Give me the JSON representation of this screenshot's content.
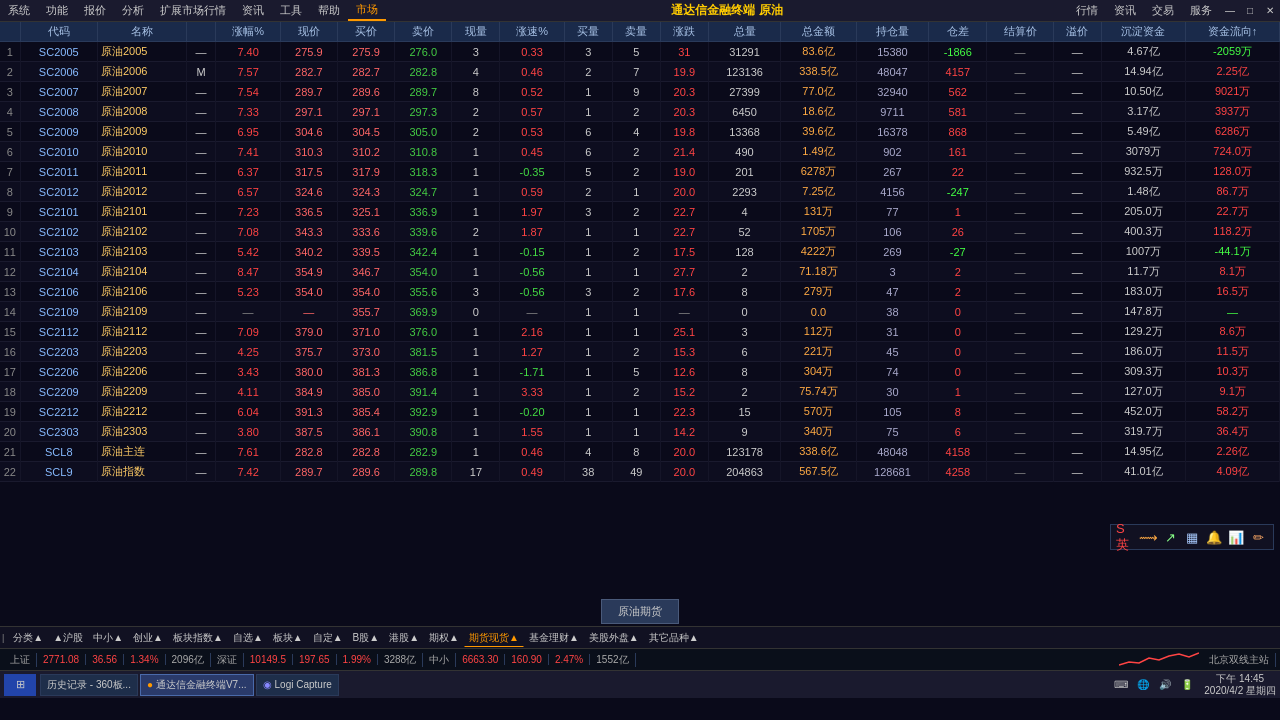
{
  "app": {
    "title": "通达信金融终端 原油",
    "menu": [
      "系统",
      "功能",
      "报价",
      "分析",
      "扩展市场行情",
      "资讯",
      "工具",
      "帮助",
      "市场"
    ],
    "window_controls": [
      "行情",
      "资讯",
      "交易",
      "服务"
    ]
  },
  "table": {
    "headers": [
      "",
      "代码",
      "名称",
      "",
      "涨幅%",
      "现价",
      "买价",
      "卖价",
      "现量",
      "涨速%",
      "买量",
      "卖量",
      "涨跌",
      "总量",
      "总金额",
      "持仓量",
      "仓差",
      "结算价",
      "溢价",
      "沉淀资金",
      "资金流向↑"
    ],
    "rows": [
      {
        "num": "1",
        "code": "SC2005",
        "name": "原油2005",
        "flag": "",
        "pct": "7.40",
        "price": "275.9",
        "buy": "275.9",
        "sell": "276.0",
        "vol": "3",
        "spd": "0.33",
        "bvol": "3",
        "svol": "5",
        "change": "31",
        "total": "31291",
        "amount": "83.6亿",
        "hold": "15380",
        "diff": "-1866",
        "settle": "—",
        "limit": "",
        "assets": "4.67亿",
        "flow": "-2059万"
      },
      {
        "num": "2",
        "code": "SC2006",
        "name": "原油2006",
        "flag": "M",
        "pct": "7.57",
        "price": "282.7",
        "buy": "282.7",
        "sell": "282.8",
        "vol": "4",
        "spd": "0.46",
        "bvol": "2",
        "svol": "7",
        "change": "19.9",
        "total": "123136",
        "amount": "338.5亿",
        "hold": "48047",
        "diff": "4157",
        "settle": "—",
        "limit": "",
        "assets": "14.94亿",
        "flow": "2.25亿"
      },
      {
        "num": "3",
        "code": "SC2007",
        "name": "原油2007",
        "flag": "",
        "pct": "7.54",
        "price": "289.7",
        "buy": "289.6",
        "sell": "289.7",
        "vol": "8",
        "spd": "0.52",
        "bvol": "1",
        "svol": "9",
        "change": "20.3",
        "total": "27399",
        "amount": "77.0亿",
        "hold": "32940",
        "diff": "562",
        "settle": "—",
        "limit": "",
        "assets": "10.50亿",
        "flow": "9021万"
      },
      {
        "num": "4",
        "code": "SC2008",
        "name": "原油2008",
        "flag": "",
        "pct": "7.33",
        "price": "297.1",
        "buy": "297.1",
        "sell": "297.3",
        "vol": "2",
        "spd": "0.57",
        "bvol": "1",
        "svol": "2",
        "change": "20.3",
        "total": "6450",
        "amount": "18.6亿",
        "hold": "9711",
        "diff": "581",
        "settle": "—",
        "limit": "",
        "assets": "3.17亿",
        "flow": "3937万"
      },
      {
        "num": "5",
        "code": "SC2009",
        "name": "原油2009",
        "flag": "",
        "pct": "6.95",
        "price": "304.6",
        "buy": "304.5",
        "sell": "305.0",
        "vol": "2",
        "spd": "0.53",
        "bvol": "6",
        "svol": "4",
        "change": "19.8",
        "total": "13368",
        "amount": "39.6亿",
        "hold": "16378",
        "diff": "868",
        "settle": "—",
        "limit": "",
        "assets": "5.49亿",
        "flow": "6286万"
      },
      {
        "num": "6",
        "code": "SC2010",
        "name": "原油2010",
        "flag": "",
        "pct": "7.41",
        "price": "310.3",
        "buy": "310.2",
        "sell": "310.8",
        "vol": "1",
        "spd": "0.45",
        "bvol": "6",
        "svol": "2",
        "change": "21.4",
        "total": "490",
        "amount": "1.49亿",
        "hold": "902",
        "diff": "161",
        "settle": "—",
        "limit": "",
        "assets": "3079万",
        "flow": "724.0万"
      },
      {
        "num": "7",
        "code": "SC2011",
        "name": "原油2011",
        "flag": "",
        "pct": "6.37",
        "price": "317.5",
        "buy": "317.9",
        "sell": "318.3",
        "vol": "1",
        "spd": "-0.35",
        "bvol": "5",
        "svol": "2",
        "change": "19.0",
        "total": "201",
        "amount": "6278万",
        "hold": "267",
        "diff": "22",
        "settle": "—",
        "limit": "",
        "assets": "932.5万",
        "flow": "128.0万"
      },
      {
        "num": "8",
        "code": "SC2012",
        "name": "原油2012",
        "flag": "",
        "pct": "6.57",
        "price": "324.6",
        "buy": "324.3",
        "sell": "324.7",
        "vol": "1",
        "spd": "0.59",
        "bvol": "2",
        "svol": "1",
        "change": "20.0",
        "total": "2293",
        "amount": "7.25亿",
        "hold": "4156",
        "diff": "-247",
        "settle": "—",
        "limit": "",
        "assets": "1.48亿",
        "flow": "86.7万"
      },
      {
        "num": "9",
        "code": "SC2101",
        "name": "原油2101",
        "flag": "",
        "pct": "7.23",
        "price": "336.5",
        "buy": "325.1",
        "sell": "336.9",
        "vol": "1",
        "spd": "1.97",
        "bvol": "3",
        "svol": "2",
        "change": "22.7",
        "total": "4",
        "amount": "131万",
        "hold": "77",
        "diff": "1",
        "settle": "—",
        "limit": "",
        "assets": "205.0万",
        "flow": "22.7万"
      },
      {
        "num": "10",
        "code": "SC2102",
        "name": "原油2102",
        "flag": "",
        "pct": "7.08",
        "price": "343.3",
        "buy": "333.6",
        "sell": "339.6",
        "vol": "2",
        "spd": "1.87",
        "bvol": "1",
        "svol": "1",
        "change": "22.7",
        "total": "52",
        "amount": "1705万",
        "hold": "106",
        "diff": "26",
        "settle": "—",
        "limit": "",
        "assets": "400.3万",
        "flow": "118.2万"
      },
      {
        "num": "11",
        "code": "SC2103",
        "name": "原油2103",
        "flag": "",
        "pct": "5.42",
        "price": "340.2",
        "buy": "339.5",
        "sell": "342.4",
        "vol": "1",
        "spd": "-0.15",
        "bvol": "1",
        "svol": "2",
        "change": "17.5",
        "total": "128",
        "amount": "4222万",
        "hold": "269",
        "diff": "-27",
        "settle": "—",
        "limit": "",
        "assets": "1007万",
        "flow": "-44.1万"
      },
      {
        "num": "12",
        "code": "SC2104",
        "name": "原油2104",
        "flag": "",
        "pct": "8.47",
        "price": "354.9",
        "buy": "346.7",
        "sell": "354.0",
        "vol": "1",
        "spd": "-0.56",
        "bvol": "1",
        "svol": "1",
        "change": "27.7",
        "total": "2",
        "amount": "71.18万",
        "hold": "3",
        "diff": "2",
        "settle": "—",
        "limit": "",
        "assets": "11.7万",
        "flow": "8.1万"
      },
      {
        "num": "13",
        "code": "SC2106",
        "name": "原油2106",
        "flag": "",
        "pct": "5.23",
        "price": "354.0",
        "buy": "354.0",
        "sell": "355.6",
        "vol": "3",
        "spd": "-0.56",
        "bvol": "3",
        "svol": "2",
        "change": "17.6",
        "total": "8",
        "amount": "279万",
        "hold": "47",
        "diff": "2",
        "settle": "—",
        "limit": "",
        "assets": "183.0万",
        "flow": "16.5万"
      },
      {
        "num": "14",
        "code": "SC2109",
        "name": "原油2109",
        "flag": "",
        "pct": "—",
        "price": "—",
        "buy": "355.7",
        "sell": "369.9",
        "vol": "0",
        "spd": "—",
        "bvol": "1",
        "svol": "1",
        "change": "—",
        "total": "0",
        "amount": "0.0",
        "hold": "38",
        "diff": "0",
        "settle": "—",
        "limit": "",
        "assets": "147.8万",
        "flow": "—"
      },
      {
        "num": "15",
        "code": "SC2112",
        "name": "原油2112",
        "flag": "",
        "pct": "7.09",
        "price": "379.0",
        "buy": "371.0",
        "sell": "376.0",
        "vol": "1",
        "spd": "2.16",
        "bvol": "1",
        "svol": "1",
        "change": "25.1",
        "total": "3",
        "amount": "112万",
        "hold": "31",
        "diff": "0",
        "settle": "—",
        "limit": "",
        "assets": "129.2万",
        "flow": "8.6万"
      },
      {
        "num": "16",
        "code": "SC2203",
        "name": "原油2203",
        "flag": "",
        "pct": "4.25",
        "price": "375.7",
        "buy": "373.0",
        "sell": "381.5",
        "vol": "1",
        "spd": "1.27",
        "bvol": "1",
        "svol": "2",
        "change": "15.3",
        "total": "6",
        "amount": "221万",
        "hold": "45",
        "diff": "0",
        "settle": "—",
        "limit": "",
        "assets": "186.0万",
        "flow": "11.5万"
      },
      {
        "num": "17",
        "code": "SC2206",
        "name": "原油2206",
        "flag": "",
        "pct": "3.43",
        "price": "380.0",
        "buy": "381.3",
        "sell": "386.8",
        "vol": "1",
        "spd": "-1.71",
        "bvol": "1",
        "svol": "5",
        "change": "12.6",
        "total": "8",
        "amount": "304万",
        "hold": "74",
        "diff": "0",
        "settle": "—",
        "limit": "",
        "assets": "309.3万",
        "flow": "10.3万"
      },
      {
        "num": "18",
        "code": "SC2209",
        "name": "原油2209",
        "flag": "",
        "pct": "4.11",
        "price": "384.9",
        "buy": "385.0",
        "sell": "391.4",
        "vol": "1",
        "spd": "3.33",
        "bvol": "1",
        "svol": "2",
        "change": "15.2",
        "total": "2",
        "amount": "75.74万",
        "hold": "30",
        "diff": "1",
        "settle": "—",
        "limit": "",
        "assets": "127.0万",
        "flow": "9.1万"
      },
      {
        "num": "19",
        "code": "SC2212",
        "name": "原油2212",
        "flag": "",
        "pct": "6.04",
        "price": "391.3",
        "buy": "385.4",
        "sell": "392.9",
        "vol": "1",
        "spd": "-0.20",
        "bvol": "1",
        "svol": "1",
        "change": "22.3",
        "total": "15",
        "amount": "570万",
        "hold": "105",
        "diff": "8",
        "settle": "—",
        "limit": "",
        "assets": "452.0万",
        "flow": "58.2万"
      },
      {
        "num": "20",
        "code": "SC2303",
        "name": "原油2303",
        "flag": "",
        "pct": "3.80",
        "price": "387.5",
        "buy": "386.1",
        "sell": "390.8",
        "vol": "1",
        "spd": "1.55",
        "bvol": "1",
        "svol": "1",
        "change": "14.2",
        "total": "9",
        "amount": "340万",
        "hold": "75",
        "diff": "6",
        "settle": "—",
        "limit": "",
        "assets": "319.7万",
        "flow": "36.4万"
      },
      {
        "num": "21",
        "code": "SCL8",
        "name": "原油主连",
        "flag": "",
        "pct": "7.61",
        "price": "282.8",
        "buy": "282.8",
        "sell": "282.9",
        "vol": "1",
        "spd": "0.46",
        "bvol": "4",
        "svol": "8",
        "change": "20.0",
        "total": "123178",
        "amount": "338.6亿",
        "hold": "48048",
        "diff": "4158",
        "settle": "—",
        "limit": "",
        "assets": "14.95亿",
        "flow": "2.26亿"
      },
      {
        "num": "22",
        "code": "SCL9",
        "name": "原油指数",
        "flag": "",
        "pct": "7.42",
        "price": "289.7",
        "buy": "289.6",
        "sell": "289.8",
        "vol": "17",
        "spd": "0.49",
        "bvol": "38",
        "svol": "49",
        "change": "20.0",
        "total": "204863",
        "amount": "567.5亿",
        "hold": "128681",
        "diff": "4258",
        "settle": "—",
        "limit": "",
        "assets": "41.01亿",
        "flow": "4.09亿"
      }
    ]
  },
  "center_button": "原油期货",
  "bottom_tabs": [
    {
      "label": "分类▲",
      "active": false
    },
    {
      "label": "▲沪股",
      "active": false
    },
    {
      "label": "中小▲",
      "active": false
    },
    {
      "label": "创业▲",
      "active": false
    },
    {
      "label": "板块指数▲",
      "active": false
    },
    {
      "label": "自选▲",
      "active": false
    },
    {
      "label": "板块▲",
      "active": false
    },
    {
      "label": "自定▲",
      "active": false
    },
    {
      "label": "B股▲",
      "active": false
    },
    {
      "label": "港股▲",
      "active": false
    },
    {
      "label": "期权▲",
      "active": false
    },
    {
      "label": "期货现货▲",
      "active": true
    },
    {
      "label": "基金理财▲",
      "active": false
    },
    {
      "label": "美股外盘▲",
      "active": false
    },
    {
      "label": "其它品种▲",
      "active": false
    }
  ],
  "status_bar": {
    "sh": {
      "label": "上证",
      "value": "2771.08",
      "change": "36.56",
      "pct": "1.34%",
      "vol": "2096亿"
    },
    "sz": {
      "label": "深证",
      "value": "10149.5",
      "change": "197.65",
      "pct": "1.99%",
      "vol": "3288亿"
    },
    "zx": {
      "label": "中小",
      "value": "6663.30",
      "change": "160.90",
      "pct": "2.47%",
      "vol": "1552亿"
    },
    "net": "北京双线主站"
  },
  "taskbar": {
    "start_icon": "⊞",
    "apps": [
      {
        "label": "历史记录 - 360板..."
      },
      {
        "label": "通达信金融终端V7..."
      },
      {
        "label": "Logi Capture"
      }
    ],
    "time": "下午 14:45",
    "date": "2020/4/2 星期四"
  },
  "icon_toolbar": {
    "icons": [
      "S英",
      "🔱",
      "↗",
      "▦",
      "🔔",
      "📊",
      "✏"
    ]
  }
}
